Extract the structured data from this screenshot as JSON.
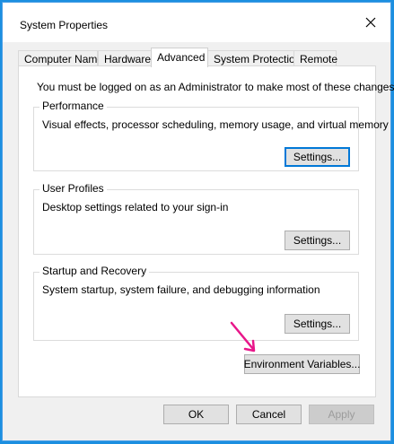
{
  "window": {
    "title": "System Properties"
  },
  "tabs": [
    {
      "label": "Computer Name"
    },
    {
      "label": "Hardware"
    },
    {
      "label": "Advanced"
    },
    {
      "label": "System Protection"
    },
    {
      "label": "Remote"
    }
  ],
  "active_tab": "Advanced",
  "notice": "You must be logged on as an Administrator to make most of these changes.",
  "groups": {
    "performance": {
      "title": "Performance",
      "description": "Visual effects, processor scheduling, memory usage, and virtual memory",
      "button": "Settings..."
    },
    "user_profiles": {
      "title": "User Profiles",
      "description": "Desktop settings related to your sign-in",
      "button": "Settings..."
    },
    "startup_recovery": {
      "title": "Startup and Recovery",
      "description": "System startup, system failure, and debugging information",
      "button": "Settings..."
    }
  },
  "environment_button": "Environment Variables...",
  "footer": {
    "ok": "OK",
    "cancel": "Cancel",
    "apply": "Apply"
  },
  "colors": {
    "desktop": "#1c8fe0",
    "accent": "#0078d7",
    "annotation_arrow": "#e8178a"
  },
  "icons": {
    "close": "close-icon",
    "annotation": "pink-arrow-icon"
  }
}
